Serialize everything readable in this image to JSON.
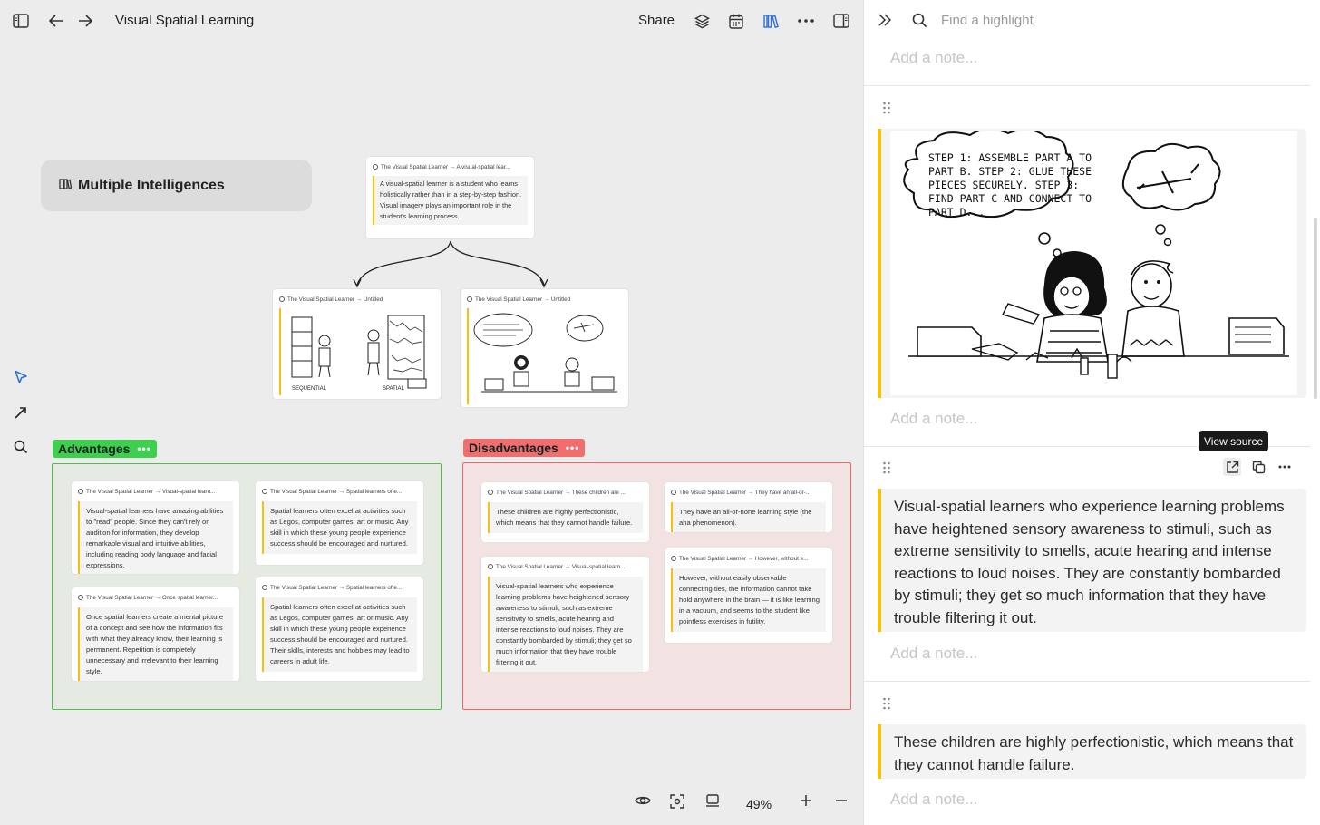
{
  "header": {
    "title": "Visual Spatial Learning",
    "share_label": "Share",
    "icons": [
      "sidebar-toggle-icon",
      "back-arrow-icon",
      "forward-arrow-icon",
      "layers-icon",
      "calendar-icon",
      "library-icon",
      "more-icon",
      "panel-right-icon"
    ]
  },
  "canvas": {
    "group_card": {
      "label": "Multiple Intelligences",
      "icon": "group-icon"
    },
    "root_card": {
      "source": "The Visual Spatial Learner → A visual-spatial lear...",
      "text": "A visual-spatial learner is a student who learns holistically rather than in a step-by-step fashion. Visual imagery plays an important role in the student's learning process."
    },
    "image_cards": [
      {
        "source": "The Visual Spatial Learner → Untitled",
        "caption_left": "SEQUENTIAL",
        "caption_right": "SPATIAL"
      },
      {
        "source": "The Visual Spatial Learner → Untitled"
      }
    ],
    "advantages": {
      "label": "Advantages",
      "more": "•••",
      "color": "#3fcf4f",
      "cards": [
        {
          "source": "The Visual Spatial Learner → Visual-spatial learn...",
          "text": "Visual-spatial learners have amazing abilities to \"read\" people. Since they can't rely on audition for information, they develop remarkable visual and intuitive abilities, including reading body language and facial expressions."
        },
        {
          "source": "The Visual Spatial Learner → Spatial learners ofte...",
          "text": "Spatial learners often excel at activities such as Legos, computer games, art or music. Any skill in which these young people experience success should be encouraged and nurtured."
        },
        {
          "source": "The Visual Spatial Learner → Once spatial learner...",
          "text": "Once spatial learners create a mental picture of a concept and see how the information fits with what they already know, their learning is permanent. Repetition is completely unnecessary and irrelevant to their learning style."
        },
        {
          "source": "The Visual Spatial Learner → Spatial learners ofte...",
          "text": "Spatial learners often excel at activities such as Legos, computer games, art or music. Any skill in which these young people experience success should be encouraged and nurtured. Their skills, interests and hobbies may lead to careers in adult life."
        }
      ]
    },
    "disadvantages": {
      "label": "Disadvantages",
      "more": "•••",
      "color": "#f26d6d",
      "cards": [
        {
          "source": "The Visual Spatial Learner → These children are ...",
          "text": "These children are highly perfectionistic, which means that they cannot handle failure."
        },
        {
          "source": "The Visual Spatial Learner → They have an all-or-...",
          "text": "They have an all-or-none learning style (the aha phenomenon)."
        },
        {
          "source": "The Visual Spatial Learner → Visual-spatial learn...",
          "text": "Visual-spatial learners who experience learning problems have heightened sensory awareness to stimuli, such as extreme sensitivity to smells, acute hearing and intense reactions to loud noises. They are constantly bombarded by stimuli; they get so much information that they have trouble filtering it out."
        },
        {
          "source": "The Visual Spatial Learner → However, without e...",
          "text": "However, without easily observable connecting ties, the information cannot take hold anywhere in the brain — it is like learning in a vacuum, and seems to the student like pointless exercises in futility."
        }
      ]
    },
    "left_tools": [
      "select-tool-icon",
      "arrow-tool-icon",
      "search-icon"
    ],
    "zoom": "49%",
    "bottom_tools": [
      "eye-icon",
      "fit-screen-icon",
      "frame-icon",
      "zoom-in-icon",
      "zoom-out-icon"
    ]
  },
  "cartoon": {
    "bubble_text": "STEP 1: ASSEMBLE PART A TO PART B. STEP 2: GLUE THESE PIECES SECURELY. STEP 3: FIND PART C AND CONNECT TO PART D..."
  },
  "panel": {
    "search_placeholder": "Find a highlight",
    "note_placeholder": "Add a note...",
    "tooltip": "View source",
    "highlights": [
      {
        "text": "Visual-spatial learners who experience learning problems have heightened sensory awareness to stimuli, such as extreme sensitivity to smells, acute hearing and intense reactions to loud noises. They are constantly bombarded by stimuli; they get so much information that they have trouble filtering it out."
      },
      {
        "text": "These children are highly perfectionistic, which means that they cannot handle failure."
      }
    ],
    "accent": "#f4c20d"
  }
}
